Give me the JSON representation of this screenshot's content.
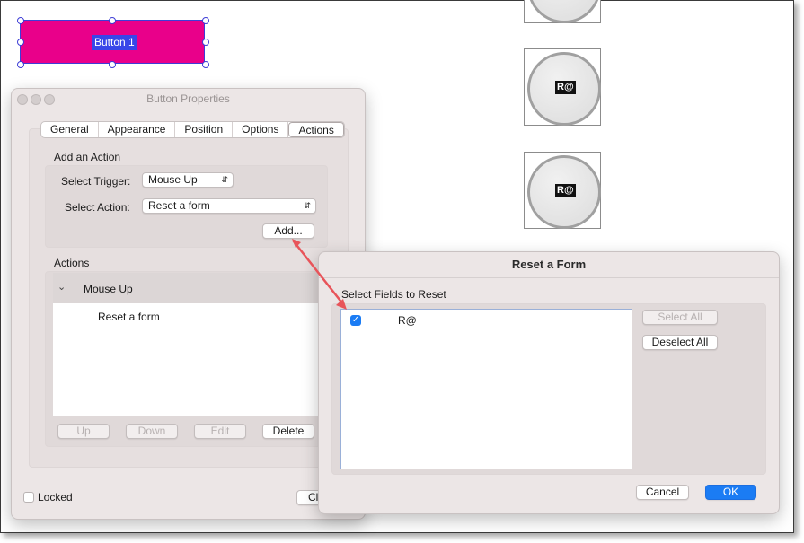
{
  "canvas": {
    "button_label": "Button 1",
    "radio_labels": [
      "R@",
      "R@"
    ],
    "colors": {
      "button_fill": "#e9008a",
      "selection": "#3846e8"
    }
  },
  "button_properties": {
    "title": "Button Properties",
    "tabs": [
      "General",
      "Appearance",
      "Position",
      "Options",
      "Actions"
    ],
    "active_tab": "Actions",
    "add_action": {
      "heading": "Add an Action",
      "trigger_label": "Select Trigger:",
      "trigger_value": "Mouse Up",
      "action_label": "Select Action:",
      "action_value": "Reset a form",
      "add_button": "Add..."
    },
    "actions": {
      "heading": "Actions",
      "group": "Mouse Up",
      "item": "Reset a form",
      "buttons": {
        "up": "Up",
        "down": "Down",
        "edit": "Edit",
        "delete": "Delete"
      }
    },
    "locked_label": "Locked",
    "close_button": "Cl"
  },
  "reset_form": {
    "title": "Reset a Form",
    "fields_heading": "Select Fields to Reset",
    "fields": [
      {
        "name": "R@",
        "checked": true
      }
    ],
    "select_all": "Select All",
    "deselect_all": "Deselect All",
    "cancel": "Cancel",
    "ok": "OK",
    "accent": "#1b7cf4"
  },
  "annotation": {
    "arrow_color": "#e8545a"
  }
}
